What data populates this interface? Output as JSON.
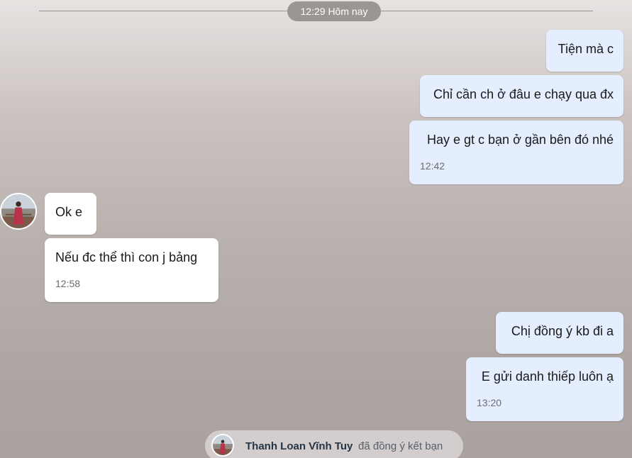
{
  "date_separator": "12:29 Hôm nay",
  "messages": [
    {
      "text": "Tiện mà c",
      "time": ""
    },
    {
      "text": "Chỉ cần ch ở đâu e chạy qua đx",
      "time": ""
    },
    {
      "text": "Hay e gt c bạn ở gần bên đó nhé",
      "time": "12:42"
    },
    {
      "text": "Ok e",
      "time": ""
    },
    {
      "text": "Nếu đc thể thì con j bảng",
      "time": "12:58"
    },
    {
      "text": "Chị đồng ý kb đi a",
      "time": ""
    },
    {
      "text": "E gửi danh thiếp luôn ạ",
      "time": "13:20"
    }
  ],
  "friend_notice": {
    "name": "Thanh Loan Vĩnh Tuy",
    "action": "đã đồng ý kết bạn"
  },
  "colors": {
    "my_bubble": "#e4eefe",
    "their_bubble": "#ffffff",
    "timestamp": "#6d6d6d"
  },
  "icons": {
    "contact_avatar": "avatar-photo"
  }
}
